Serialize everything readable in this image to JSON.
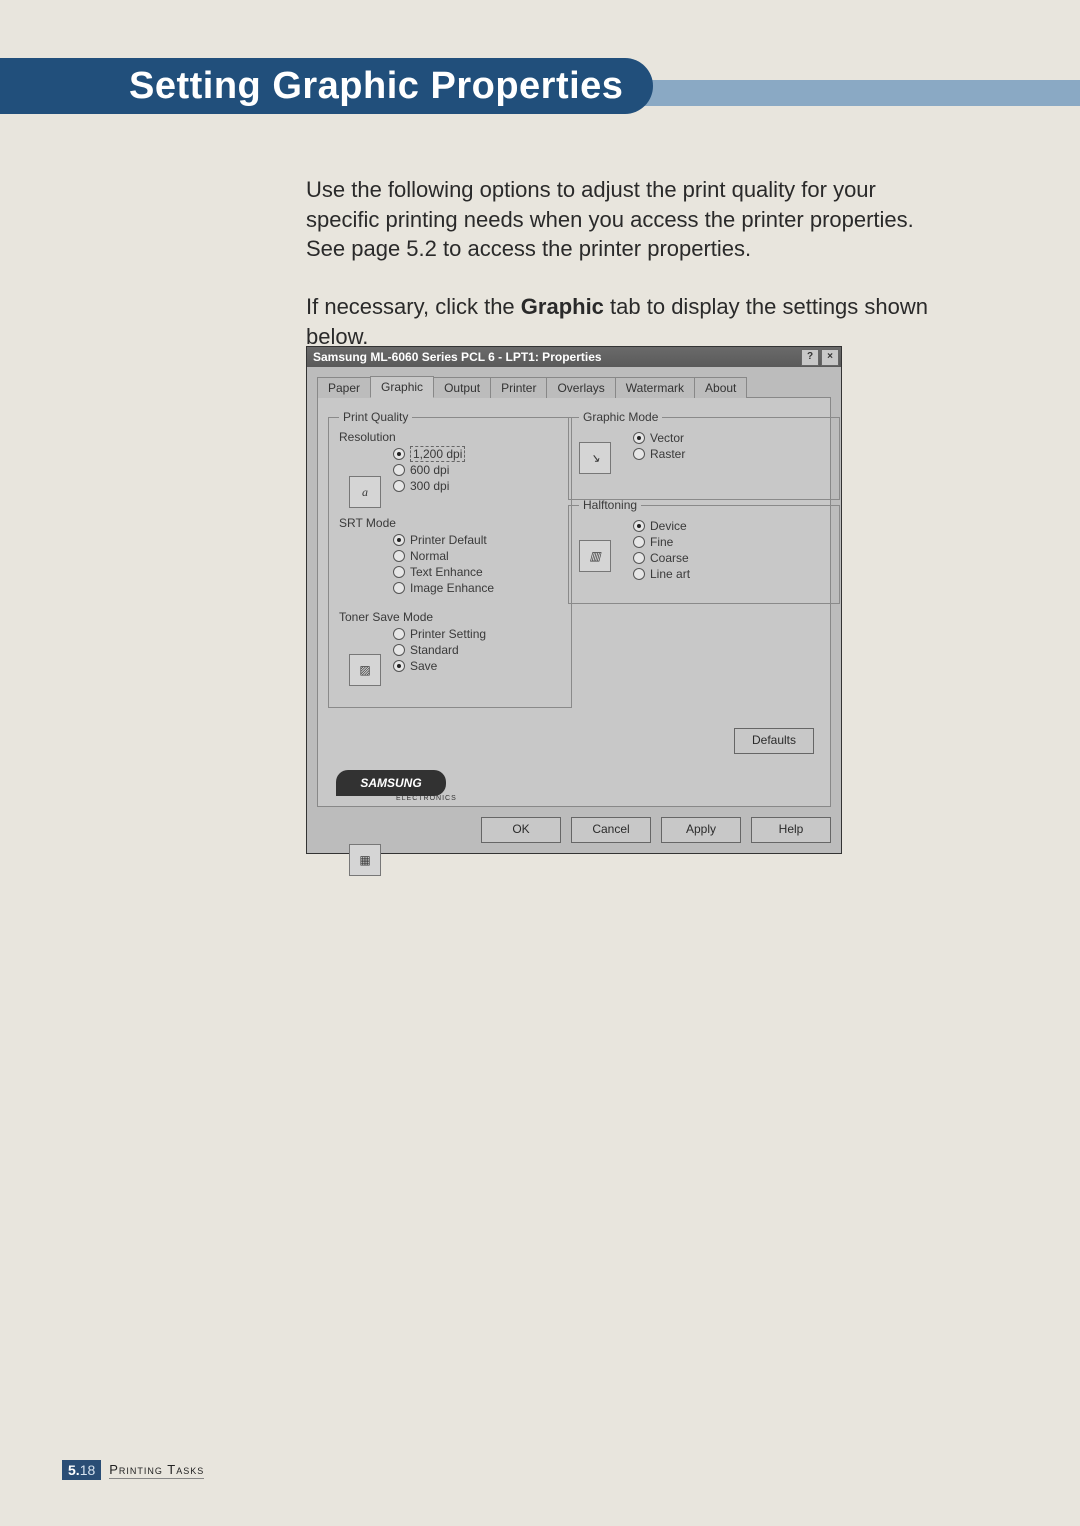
{
  "heading": "Setting Graphic Properties",
  "intro_para1": "Use the following options to adjust the print quality for your specific printing needs when you access the printer properties. See page 5.2 to access the printer properties.",
  "intro_para2_pre": "If necessary, click the ",
  "intro_para2_bold": "Graphic",
  "intro_para2_post": " tab to display the settings shown below.",
  "dialog": {
    "title": "Samsung ML-6060 Series PCL 6 - LPT1: Properties",
    "help_btn": "?",
    "close_btn": "×",
    "tabs": [
      "Paper",
      "Graphic",
      "Output",
      "Printer",
      "Overlays",
      "Watermark",
      "About"
    ],
    "active_tab_index": 1,
    "print_quality": {
      "legend": "Print Quality",
      "resolution": {
        "label": "Resolution",
        "options": [
          "1,200 dpi",
          "600 dpi",
          "300 dpi"
        ],
        "selected": 0,
        "icon_text": "a"
      },
      "srt_mode": {
        "label": "SRT Mode",
        "options": [
          "Printer Default",
          "Normal",
          "Text Enhance",
          "Image Enhance"
        ],
        "selected": 0
      },
      "toner_save": {
        "label": "Toner Save Mode",
        "options": [
          "Printer Setting",
          "Standard",
          "Save"
        ],
        "selected": 2
      }
    },
    "graphic_mode": {
      "legend": "Graphic Mode",
      "options": [
        "Vector",
        "Raster"
      ],
      "selected": 0
    },
    "halftoning": {
      "legend": "Halftoning",
      "options": [
        "Device",
        "Fine",
        "Coarse",
        "Line art"
      ],
      "selected": 0
    },
    "defaults_btn": "Defaults",
    "logo": "SAMSUNG",
    "logo_sub": "ELECTRONICS",
    "buttons": {
      "ok": "OK",
      "cancel": "Cancel",
      "apply": "Apply",
      "help": "Help"
    }
  },
  "footer": {
    "chapter_num": "5.",
    "page_num": "18",
    "section": "Printing Tasks"
  }
}
